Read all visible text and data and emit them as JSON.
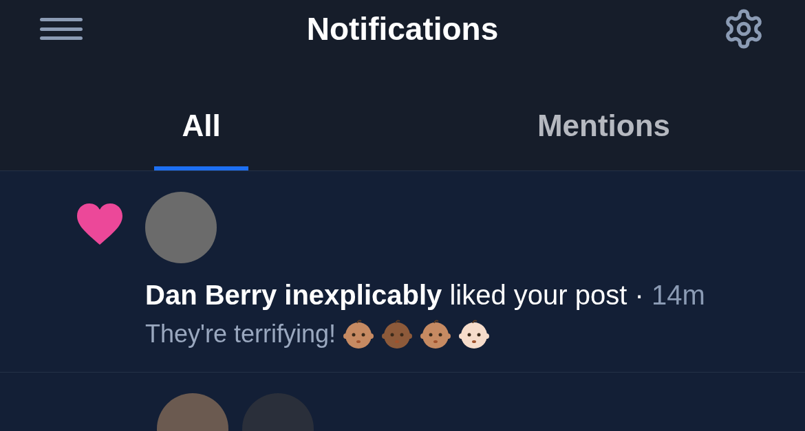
{
  "header": {
    "title": "Notifications"
  },
  "tabs": [
    {
      "label": "All",
      "selected": true
    },
    {
      "label": "Mentions",
      "selected": false
    }
  ],
  "notifications": [
    {
      "kind": "like",
      "text": "**Dan Berry inexplicably** liked your post ·",
      "time": "14m",
      "post": "They're terrifying!",
      "emoji": [
        {
          "color": "#c68a62"
        },
        {
          "color": "#8d5a3a"
        },
        {
          "color": "#c68a62"
        },
        {
          "color": "#f6dccb"
        }
      ]
    }
  ]
}
